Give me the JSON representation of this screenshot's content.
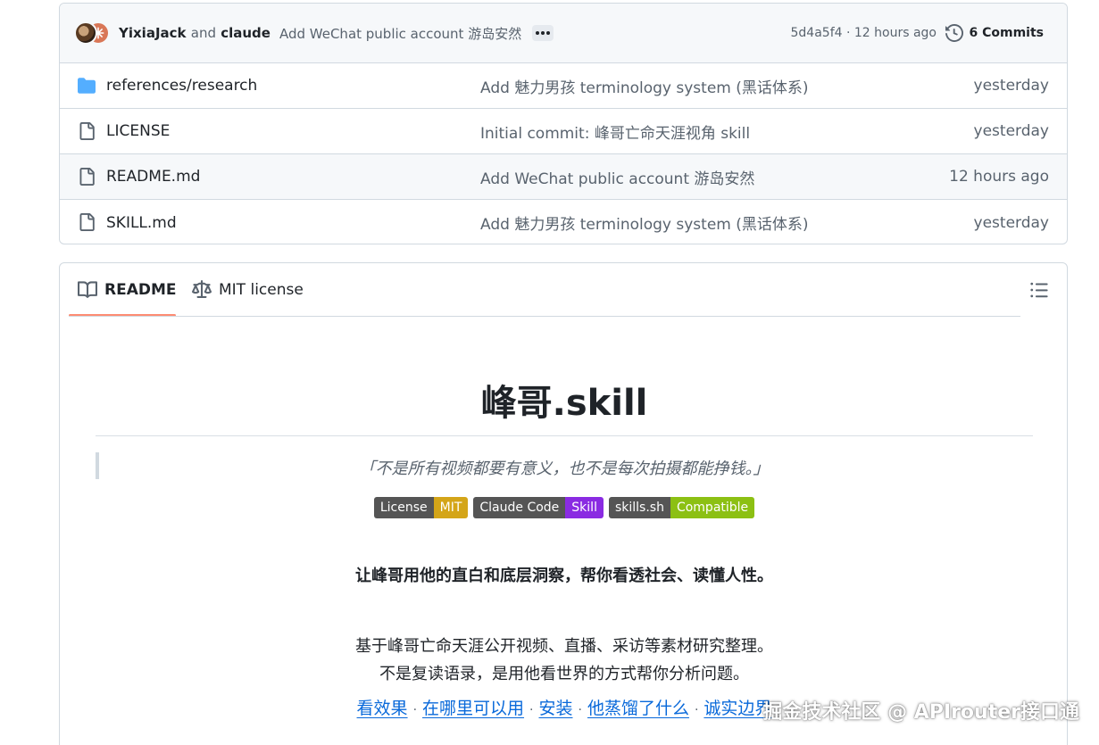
{
  "latest_commit": {
    "author1": "YixiaJack",
    "and_text": "and",
    "author2": "claude",
    "message": "Add WeChat public account 游岛安然",
    "meta": "5d4a5f4 · 12 hours ago",
    "commits_label": "6 Commits"
  },
  "files": [
    {
      "name": "references/research",
      "type": "folder",
      "commit": "Add 魅力男孩 terminology system (黑话体系)",
      "time": "yesterday"
    },
    {
      "name": "LICENSE",
      "type": "file",
      "commit": "Initial commit: 峰哥亡命天涯视角 skill",
      "time": "yesterday"
    },
    {
      "name": "README.md",
      "type": "file",
      "commit": "Add WeChat public account 游岛安然",
      "time": "12 hours ago"
    },
    {
      "name": "SKILL.md",
      "type": "file",
      "commit": "Add 魅力男孩 terminology system (黑话体系)",
      "time": "yesterday"
    }
  ],
  "readme_tabs": {
    "readme": "README",
    "license": "MIT license"
  },
  "readme": {
    "title": "峰哥.skill",
    "quote": "「不是所有视频都要有意义，也不是每次拍摄都能挣钱。」",
    "badges": [
      {
        "label": "License",
        "value": "MIT",
        "color": "#d4a518"
      },
      {
        "label": "Claude Code",
        "value": "Skill",
        "color": "#8a2be2"
      },
      {
        "label": "skills.sh",
        "value": "Compatible",
        "color": "#8cc013"
      }
    ],
    "tagline": "让峰哥用他的直白和底层洞察，帮你看透社会、读懂人性。",
    "desc_line1": "基于峰哥亡命天涯公开视频、直播、采访等素材研究整理。",
    "desc_line2": "不是复读语录，是用他看世界的方式帮你分析问题。",
    "links": [
      "看效果",
      "在哪里可以用",
      "安装",
      "他蒸馏了什么",
      "诚实边界"
    ],
    "link_separator": "·"
  },
  "watermark": "掘金技术社区 @ APIrouter接口通",
  "colors": {
    "folder_icon": "#54aeff",
    "accent_tab": "#fd8c73",
    "link": "#0969da"
  }
}
